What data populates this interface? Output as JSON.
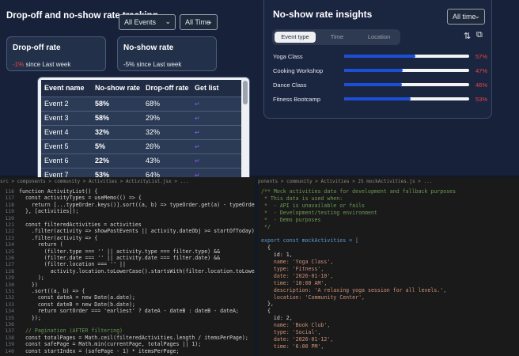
{
  "tracking": {
    "title": "Drop-off and no-show rate tracking",
    "event_filter": "All Events",
    "time_filter": "All Time",
    "dropoff_card": {
      "title": "Drop-off rate",
      "value": "-1%",
      "suffix": " since Last week"
    },
    "noshow_card": {
      "title": "No-show rate",
      "value": "-5%",
      "suffix": " since Last week"
    },
    "table": {
      "headers": [
        "Event name",
        "No-show rate",
        "Drop-off rate",
        "Get list"
      ],
      "rows": [
        [
          "Event 2",
          "58%",
          "68%",
          "↵"
        ],
        [
          "Event 3",
          "58%",
          "29%",
          "↵"
        ],
        [
          "Event 4",
          "32%",
          "32%",
          "↵"
        ],
        [
          "Event 5",
          "5%",
          "26%",
          "↵"
        ],
        [
          "Event 6",
          "22%",
          "43%",
          "↵"
        ],
        [
          "Event 7",
          "53%",
          "64%",
          "↵"
        ]
      ]
    }
  },
  "insights": {
    "title": "No-show rate insights",
    "time_filter": "All time",
    "tabs": [
      "Event type",
      "Time",
      "Location"
    ],
    "sort_icon": "sort-arrows-icon",
    "export_icon": "external-link-icon",
    "rows": [
      {
        "label": "Yoga Class",
        "pct": "57%",
        "value": 0.57
      },
      {
        "label": "Cooking Workshop",
        "pct": "47%",
        "value": 0.47
      },
      {
        "label": "Dance Class",
        "pct": "46%",
        "value": 0.46
      },
      {
        "label": "Fitness Bootcamp",
        "pct": "53%",
        "value": 0.53
      }
    ]
  },
  "left_editor": {
    "breadcrumb": "src > components > community > Activities > ActivityList.jsx > ...",
    "lines": [
      [
        "116",
        "function ActivityList() {"
      ],
      [
        "117",
        "  const activityTypes = useMemo(() => {"
      ],
      [
        "118",
        "    return [...typeOrder.keys()].sort((a, b) => typeOrder.get(a) - typeOrder.get(b));"
      ],
      [
        "119",
        "  }, [activities]);"
      ],
      [
        "120",
        ""
      ],
      [
        "121",
        "  const filteredActivities = activities"
      ],
      [
        "122",
        "    .filter(activity => showPastEvents || activity.dateObj >= startOfToday)"
      ],
      [
        "123",
        "    .filter(activity => {"
      ],
      [
        "124",
        "      return ("
      ],
      [
        "125",
        "        (filter.type === '' || activity.type === filter.type) &&"
      ],
      [
        "126",
        "        (filter.date === '' || activity.date === filter.date) &&"
      ],
      [
        "127",
        "        (filter.location === '' ||"
      ],
      [
        "128",
        "          activity.location.toLowerCase().startsWith(filter.location.toLowerCase()))"
      ],
      [
        "129",
        "      );"
      ],
      [
        "130",
        "    })"
      ],
      [
        "131",
        "    .sort((a, b) => {"
      ],
      [
        "132",
        "      const dateA = new Date(a.date);"
      ],
      [
        "133",
        "      const dateB = new Date(b.date);"
      ],
      [
        "134",
        "      return sortOrder === 'earliest' ? dateA - dateB : dateB - dateA;"
      ],
      [
        "135",
        "    });"
      ],
      [
        "136",
        ""
      ],
      [
        "137",
        "  // Pagination (AFTER filtering)"
      ],
      [
        "138",
        "  const totalPages = Math.ceil(filteredActivities.length / itemsPerPage);"
      ],
      [
        "139",
        "  const safePage = Math.min(currentPage, totalPages || 1);"
      ],
      [
        "140",
        "  const startIndex = (safePage - 1) * itemsPerPage;"
      ]
    ]
  },
  "right_editor": {
    "breadcrumb": "ponents > community > Activities > JS mockActivities.js > ...",
    "lines": [
      "/** Mock activities data for development and fallback purposes",
      " * This data is used when:",
      " *  - API is unavailable or fails",
      " *  - Development/testing environment",
      " *  - Demo purposes",
      " */",
      "",
      "export const mockActivities = [",
      "  {",
      "    id: 1,",
      "    name: 'Yoga Class',",
      "    type: 'Fitness',",
      "    date: '2026-01-10',",
      "    time: '10:00 AM',",
      "    description: 'A relaxing yoga session for all levels.',",
      "    location: 'Community Center',",
      "  },",
      "  {",
      "    id: 2,",
      "    name: 'Book Club',",
      "    type: 'Social',",
      "    date: '2026-01-12',",
      "    time: '6:00 PM',"
    ]
  }
}
